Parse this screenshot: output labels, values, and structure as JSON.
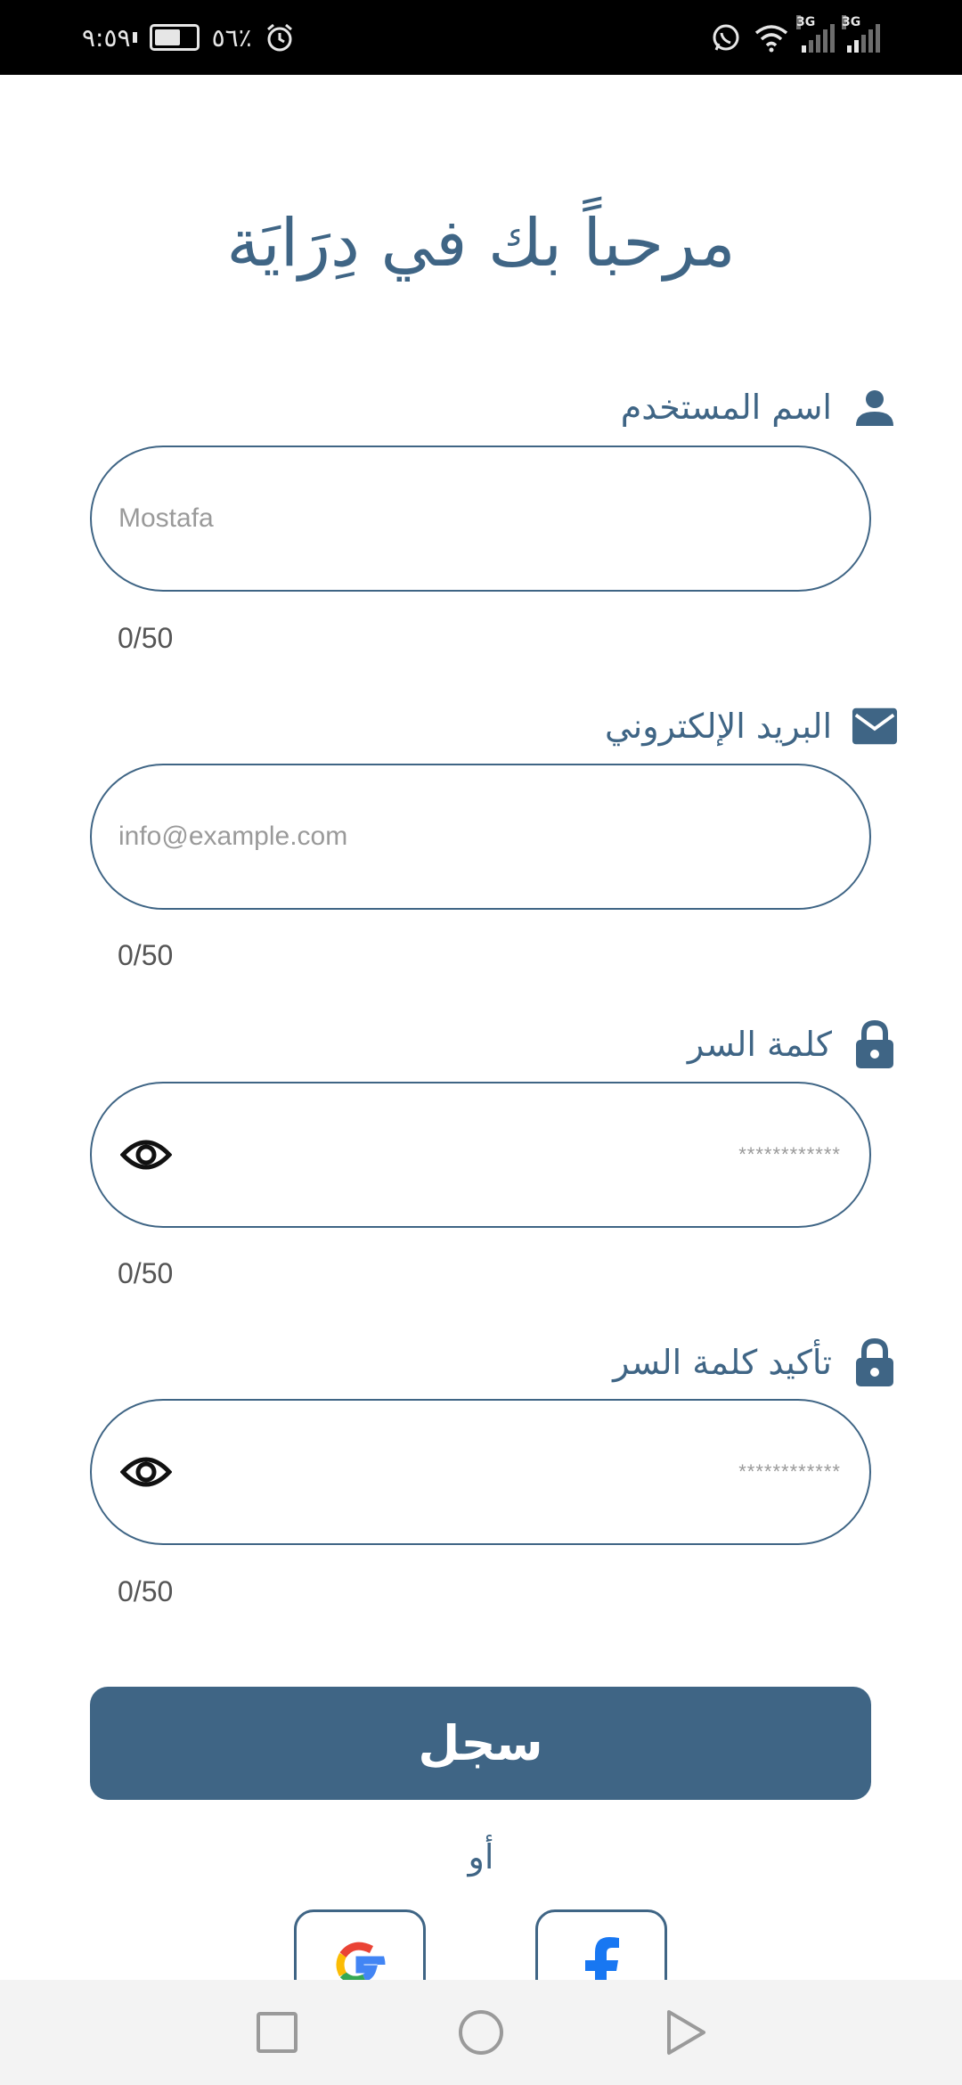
{
  "status_bar": {
    "time": "٩:٥٩",
    "battery_percent": "٥٦٪",
    "battery_level": 0.56,
    "network_1": "3G",
    "network_2": "3G"
  },
  "page": {
    "title": "مرحباً بك في دِرَايَة"
  },
  "fields": {
    "username": {
      "label": "اسم المستخدم",
      "placeholder": "Mostafa",
      "counter": "0/50",
      "icon": "person-icon"
    },
    "email": {
      "label": "البريد الإلكتروني",
      "placeholder": "info@example.com",
      "counter": "0/50",
      "icon": "mail-icon"
    },
    "password": {
      "label": "كلمة السر",
      "placeholder": "************",
      "counter": "0/50",
      "icon": "lock-icon"
    },
    "confirm_password": {
      "label": "تأكيد كلمة السر",
      "placeholder": "************",
      "counter": "0/50",
      "icon": "lock-icon"
    }
  },
  "actions": {
    "submit_label": "سجل",
    "or_label": "أو",
    "social": [
      "google-icon",
      "facebook-icon"
    ]
  },
  "colors": {
    "primary": "#3f6585",
    "placeholder": "#9a9a9a",
    "counter": "#555555"
  },
  "nav": [
    "recents-square-icon",
    "home-circle-icon",
    "back-triangle-icon"
  ]
}
